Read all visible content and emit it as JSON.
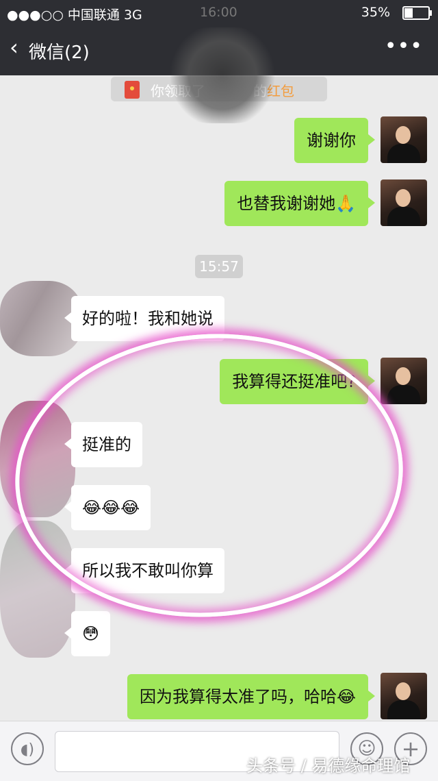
{
  "status_bar": {
    "carrier": "●●●○○ 中国联通  3G",
    "time": "16:00",
    "battery_percent": "35%",
    "battery_level": 0.35
  },
  "nav": {
    "back_icon": "chevron-left",
    "title": "微信(2)",
    "more_icon": "•••"
  },
  "system_notice": {
    "prefix": "你领取了",
    "suffix": "的",
    "red_packet": "红包"
  },
  "timestamp": "15:57",
  "messages": [
    {
      "side": "out",
      "text": "谢谢你"
    },
    {
      "side": "out",
      "text": "也替我谢谢她🙏"
    },
    {
      "side": "in",
      "text": "好的啦！我和她说"
    },
    {
      "side": "out",
      "text": "我算得还挺准吧?"
    },
    {
      "side": "in",
      "text": "挺准的"
    },
    {
      "side": "in",
      "text": "😂😂😂"
    },
    {
      "side": "in",
      "text": "所以我不敢叫你算"
    },
    {
      "side": "in",
      "text": "😳"
    },
    {
      "side": "out",
      "text": "因为我算得太准了吗，哈哈😂"
    }
  ],
  "input_bar": {
    "voice_icon": "voice-icon",
    "emoji_icon": "emoji-icon",
    "plus_icon": "plus-icon",
    "placeholder": ""
  },
  "watermark": "头条号 / 易德缘命理馆",
  "colors": {
    "nav_bg": "#2d2e33",
    "chat_bg": "#ebebeb",
    "outgoing_bubble": "#a0e75a",
    "incoming_bubble": "#ffffff",
    "highlight_circle": "#e650c8",
    "red_packet_text": "#f39c3d"
  }
}
